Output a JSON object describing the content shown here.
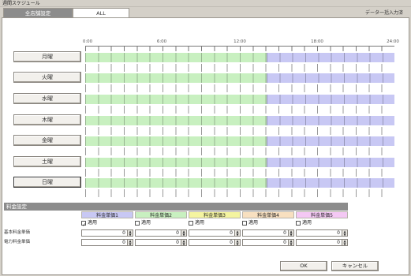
{
  "window": {
    "title": "週間スケジュール"
  },
  "tabs": [
    {
      "label": "全店舗設定",
      "active": true
    },
    {
      "label": "ALL",
      "active": false
    }
  ],
  "header_right": "データ一括入力済",
  "ruler": {
    "labels": [
      "0:00",
      "6:00",
      "12:00",
      "18:00",
      "24:00"
    ]
  },
  "days": [
    {
      "label": "月曜",
      "selected": false
    },
    {
      "label": "火曜",
      "selected": false
    },
    {
      "label": "水曜",
      "selected": false
    },
    {
      "label": "木曜",
      "selected": false
    },
    {
      "label": "金曜",
      "selected": false
    },
    {
      "label": "土曜",
      "selected": false
    },
    {
      "label": "日曜",
      "selected": true
    }
  ],
  "bar_colors": {
    "green": "#c8f0c0",
    "blue": "#c8c8f4"
  },
  "rates": {
    "section_title": "料金設定",
    "columns": [
      {
        "label": "料金単価1",
        "color": "#c8c8f4",
        "check_label": "適用",
        "checked": true
      },
      {
        "label": "料金単価2",
        "color": "#c8f0c0",
        "check_label": "適用",
        "checked": false
      },
      {
        "label": "料金単価3",
        "color": "#f4f4a0",
        "check_label": "適用",
        "checked": false
      },
      {
        "label": "料金単価4",
        "color": "#f8e0c0",
        "check_label": "適用",
        "checked": false
      },
      {
        "label": "料金単価5",
        "color": "#f4c8f4",
        "check_label": "適用",
        "checked": false
      }
    ],
    "rows": [
      {
        "label": "基本料金単価",
        "values": [
          "0",
          "0",
          "0",
          "0",
          "0"
        ]
      },
      {
        "label": "電力料金単価",
        "values": [
          "0",
          "0",
          "0",
          "0",
          "0"
        ]
      }
    ]
  },
  "buttons": {
    "ok": "OK",
    "cancel": "キャンセル"
  }
}
